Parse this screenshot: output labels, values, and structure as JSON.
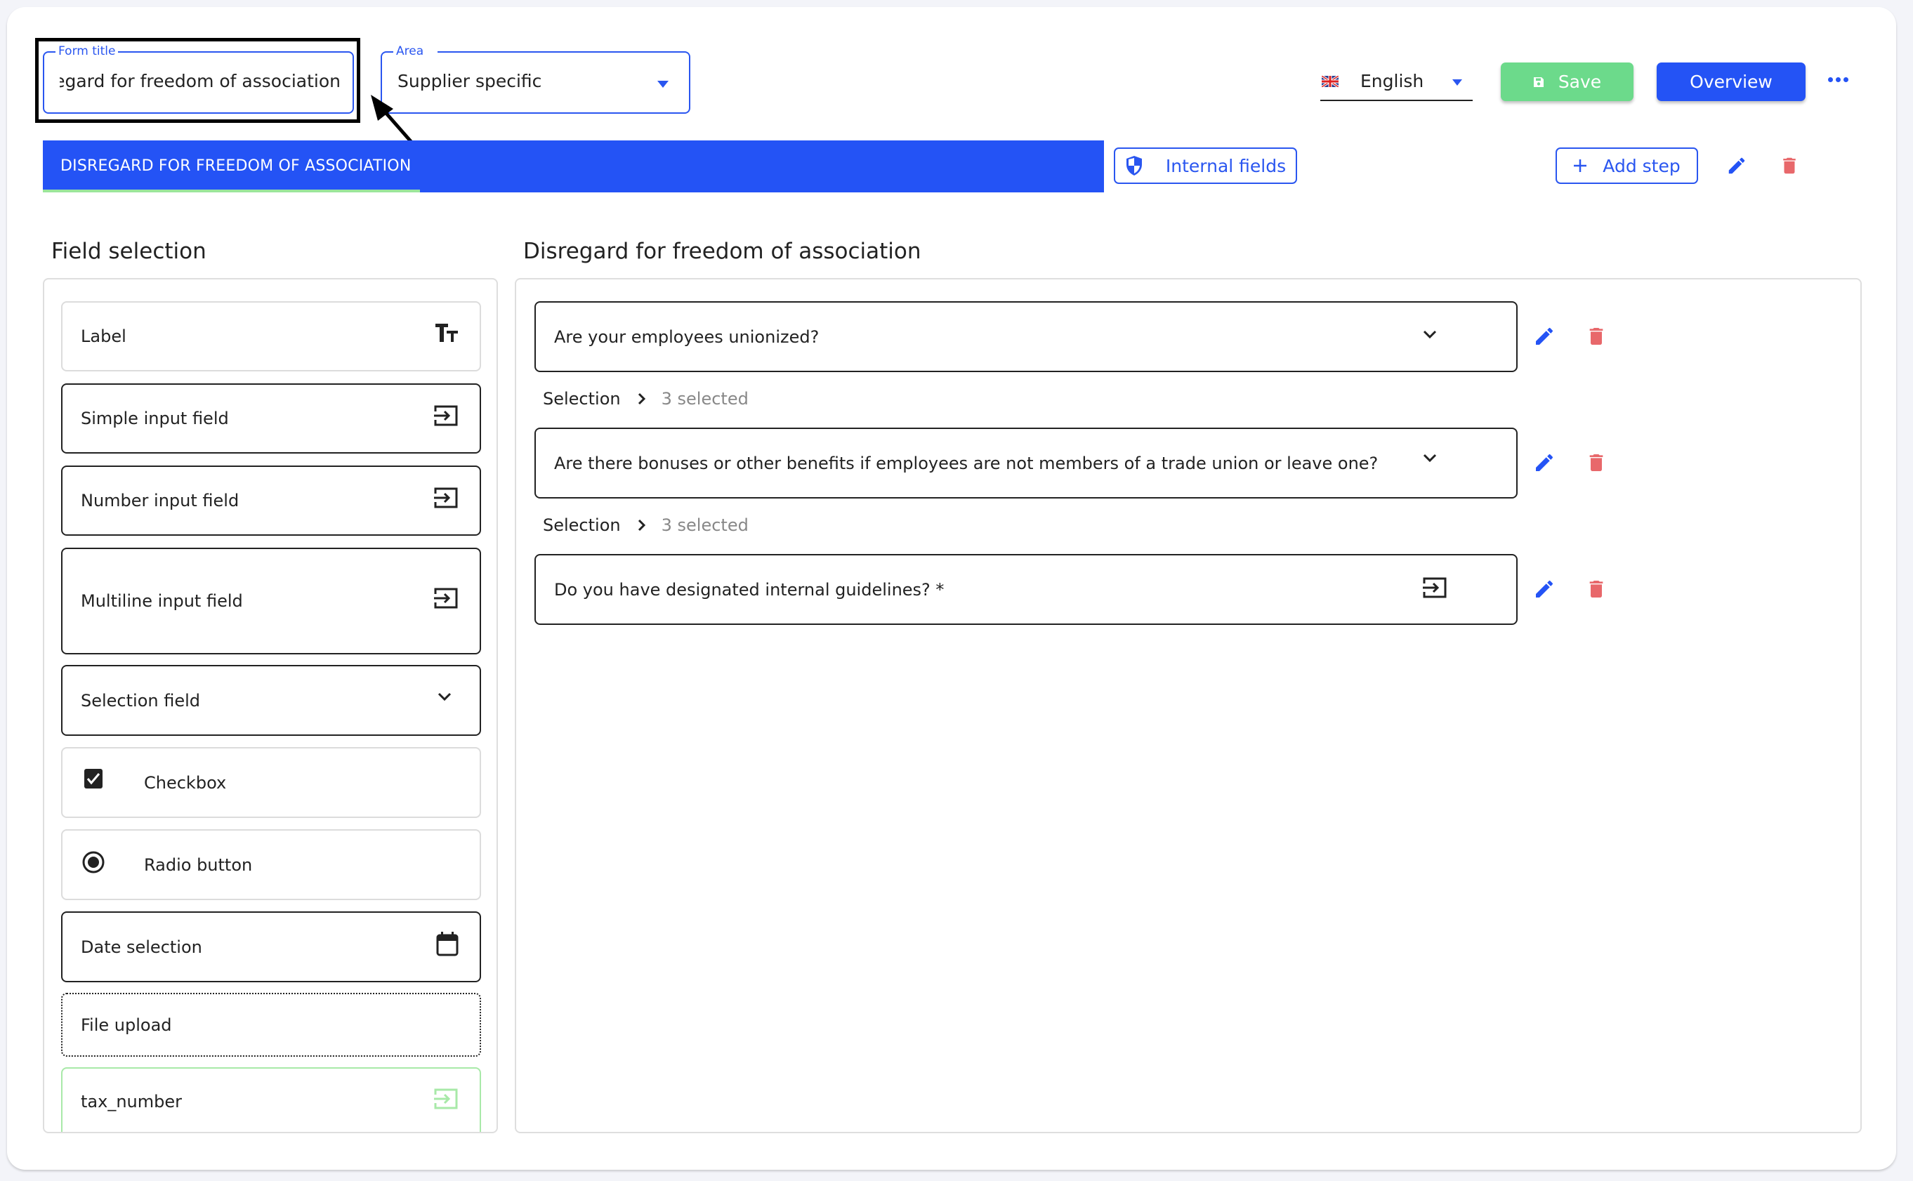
{
  "header": {
    "form_title": {
      "legend": "Form title",
      "value": "disregard for freedom of association"
    },
    "area": {
      "legend": "Area",
      "value": "Supplier specific"
    },
    "language": {
      "flag_icon": "uk-flag-icon",
      "value": "English"
    },
    "save_label": "Save",
    "overview_label": "Overview",
    "more_icon": "more-horizontal-icon"
  },
  "steps": {
    "tabs": [
      {
        "label": "DISREGARD FOR FREEDOM OF ASSOCIATION",
        "active": true
      }
    ],
    "internal_fields_label": "Internal fields",
    "add_step_label": "Add step"
  },
  "field_selection": {
    "title": "Field selection",
    "items": [
      {
        "label": "Label",
        "icon": "text-size-icon"
      },
      {
        "label": "Simple input field",
        "icon": "input-icon"
      },
      {
        "label": "Number input field",
        "icon": "input-icon"
      },
      {
        "label": "Multiline input field",
        "icon": "input-icon"
      },
      {
        "label": "Selection field",
        "icon": "chevron-down-icon"
      },
      {
        "label": "Checkbox",
        "icon": "checkbox-checked-icon"
      },
      {
        "label": "Radio button",
        "icon": "radio-checked-icon"
      },
      {
        "label": "Date selection",
        "icon": "calendar-icon"
      },
      {
        "label": "File upload",
        "icon": ""
      },
      {
        "label": "tax_number",
        "icon": "input-icon"
      }
    ]
  },
  "form_step": {
    "title": "Disregard for freedom of association",
    "questions": [
      {
        "text": "Are your employees unionized?",
        "type_icon": "chevron-down-icon",
        "selection": {
          "label": "Selection",
          "count": "3 selected"
        }
      },
      {
        "text": "Are there bonuses or other benefits if employees are not members of a trade union or leave one?",
        "type_icon": "chevron-down-icon",
        "selection": {
          "label": "Selection",
          "count": "3 selected"
        }
      },
      {
        "text": "Do you have designated internal guidelines? *",
        "type_icon": "input-icon"
      }
    ]
  },
  "colors": {
    "primary": "#2453f5",
    "save": "#6cda8b",
    "danger": "#e8686b",
    "tab_underline": "#9be59c"
  }
}
